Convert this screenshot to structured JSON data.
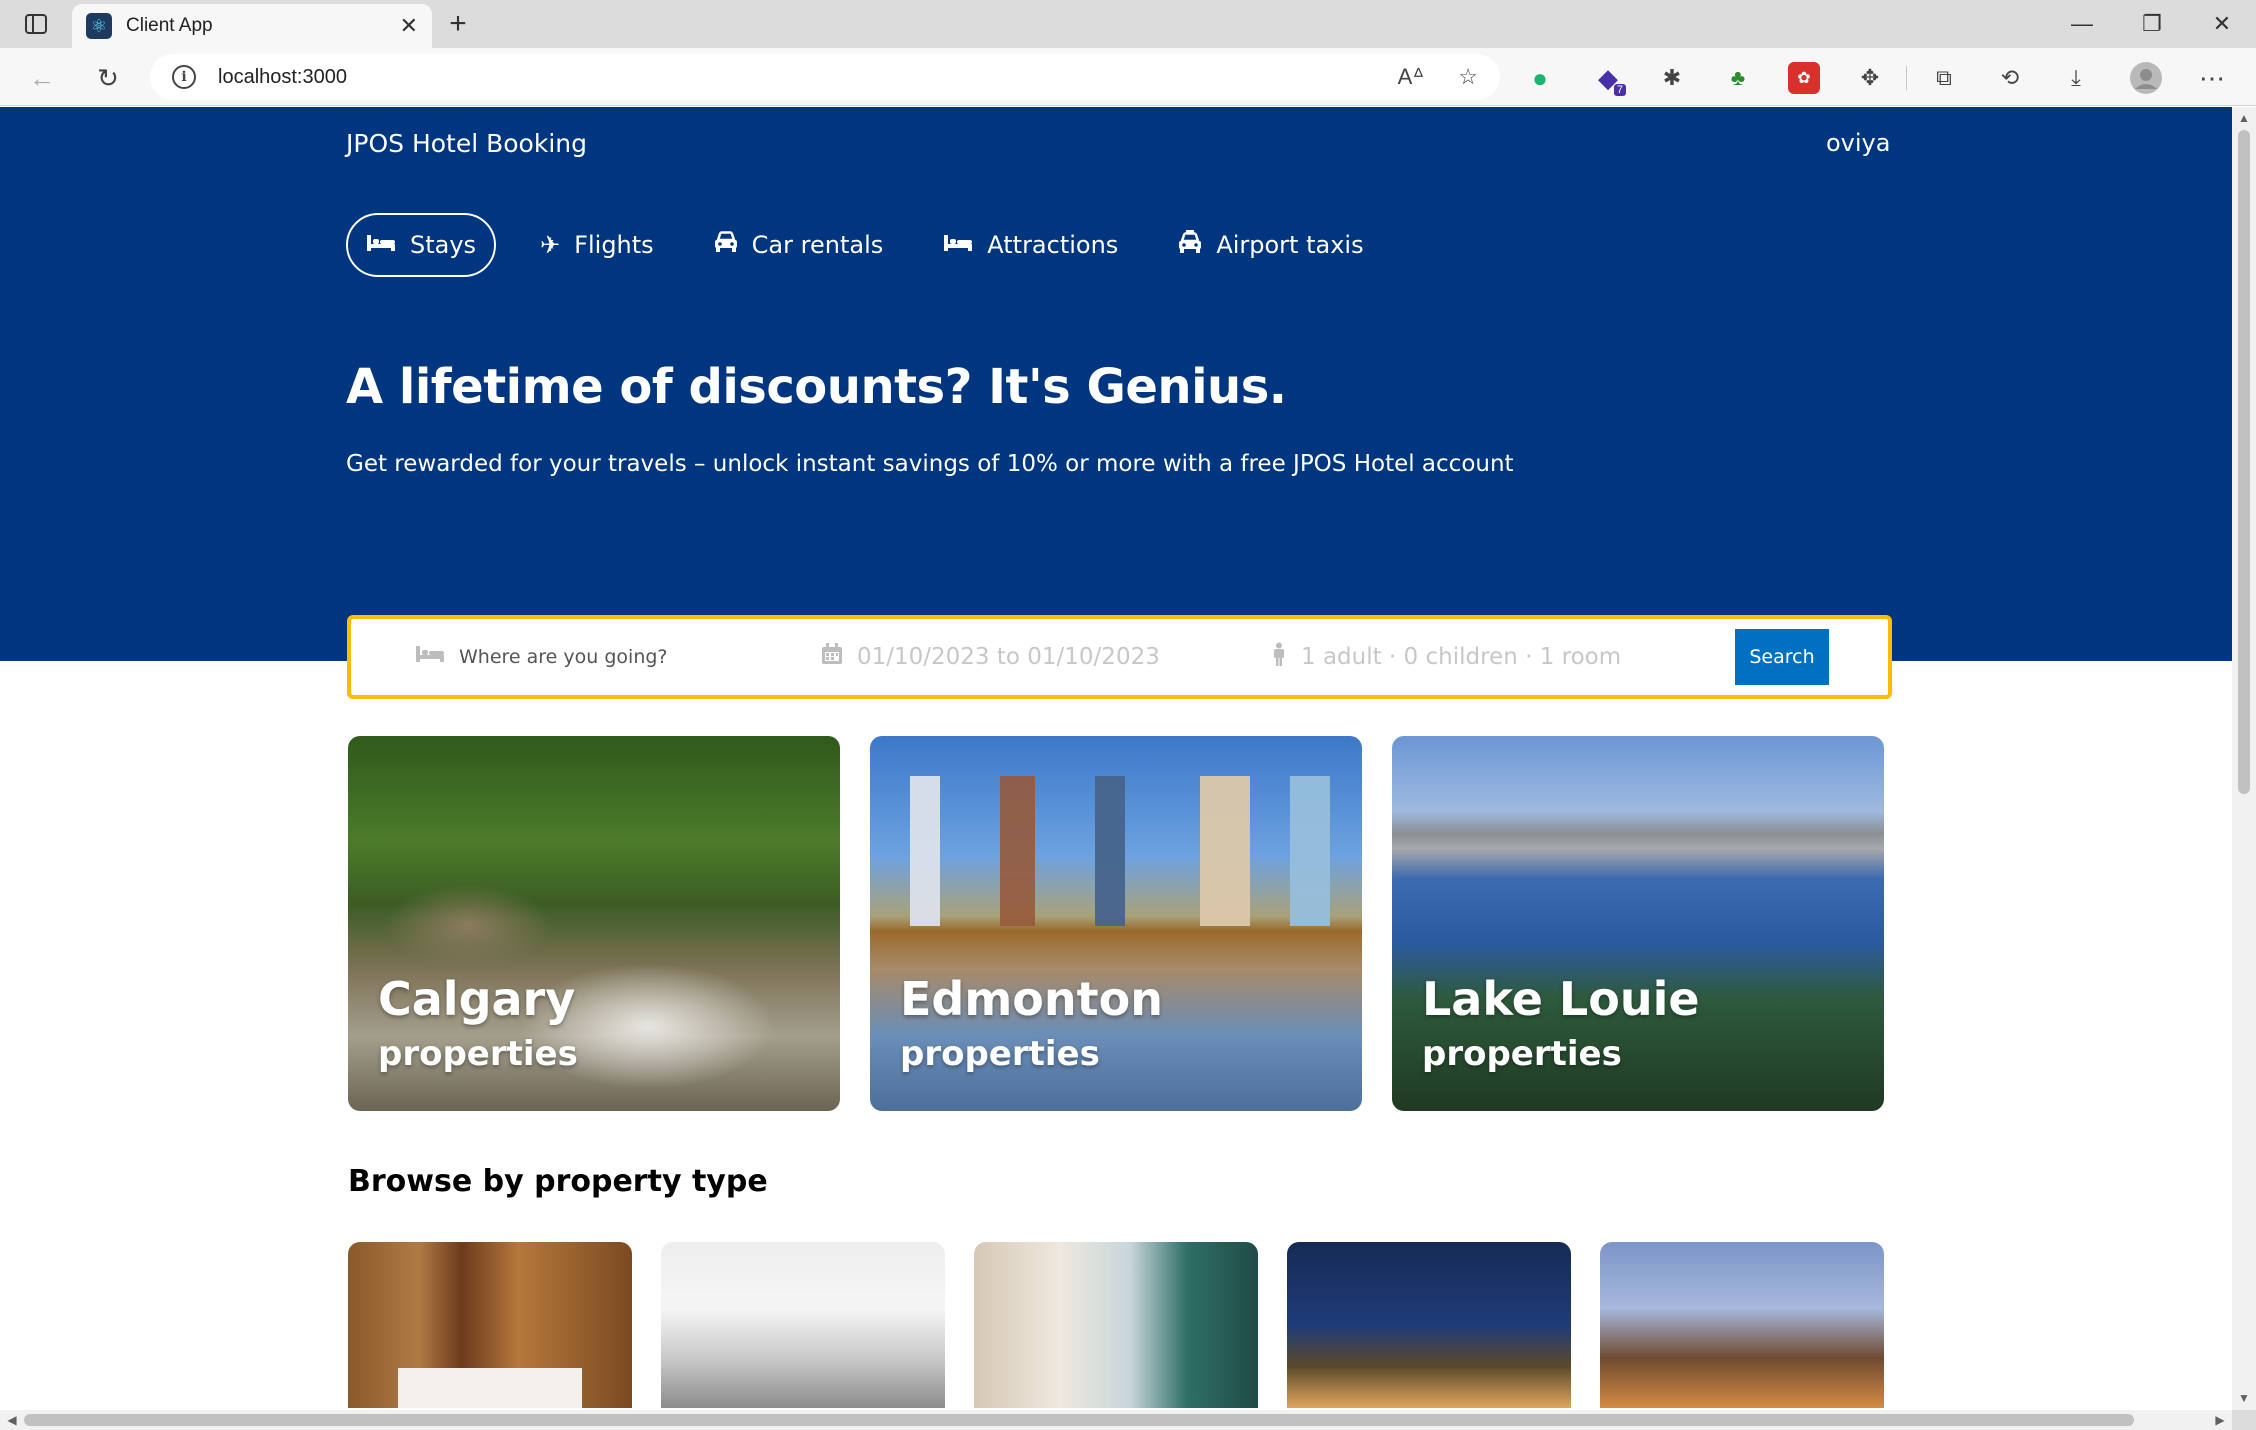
{
  "browser": {
    "tab_title": "Client App",
    "url": "localhost:3000",
    "icons": {
      "sidebar": "sidebar-toggle-icon",
      "favicon": "react-icon",
      "close": "close-icon",
      "new_tab": "plus-icon",
      "back": "arrow-left-icon",
      "reload": "reload-icon",
      "info": "info-icon",
      "read_aloud": "read-aloud-icon",
      "favorite": "star-add-icon",
      "extensions": "puzzle-icon",
      "collections": "collections-icon",
      "history": "history-icon",
      "downloads": "download-icon",
      "profile": "avatar-icon",
      "more": "ellipsis-icon"
    },
    "window_controls": {
      "minimize": "—",
      "restore": "❐",
      "close": "✕"
    },
    "extension_badge": "7"
  },
  "header": {
    "brand": "JPOS Hotel Booking",
    "user": "oviya"
  },
  "nav": {
    "items": [
      {
        "label": "Stays",
        "icon": "bed-icon",
        "active": true
      },
      {
        "label": "Flights",
        "icon": "plane-icon",
        "active": false
      },
      {
        "label": "Car rentals",
        "icon": "car-icon",
        "active": false
      },
      {
        "label": "Attractions",
        "icon": "bed-icon",
        "active": false
      },
      {
        "label": "Airport taxis",
        "icon": "taxi-icon",
        "active": false
      }
    ]
  },
  "hero": {
    "title": "A lifetime of discounts? It's Genius.",
    "subtitle": "Get rewarded for your travels – unlock instant savings of 10% or more with a free JPOS Hotel account"
  },
  "search": {
    "destination_placeholder": "Where are you going?",
    "dates": "01/10/2023 to 01/10/2023",
    "guests": "1 adult · 0 children · 1 room",
    "button": "Search"
  },
  "featured": [
    {
      "title": "Calgary",
      "subtitle": "properties"
    },
    {
      "title": "Edmonton",
      "subtitle": "properties"
    },
    {
      "title": "Lake Louie",
      "subtitle": "properties"
    }
  ],
  "browse": {
    "title": "Browse by property type"
  },
  "colors": {
    "brand_blue": "#003580",
    "search_border": "#febb02",
    "button_blue": "#0071c2"
  }
}
